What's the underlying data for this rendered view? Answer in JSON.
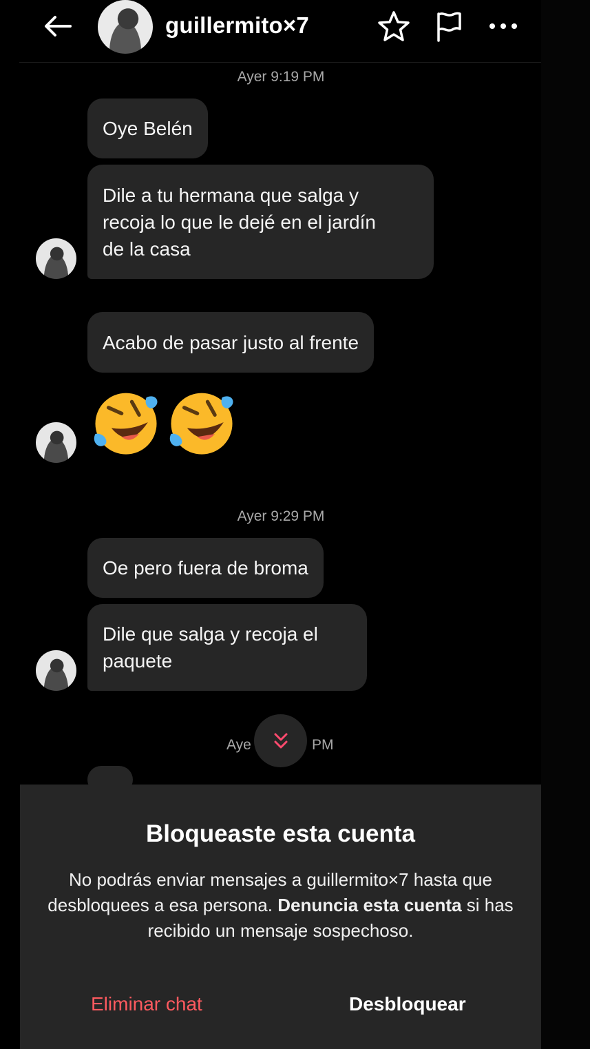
{
  "header": {
    "username": "guillermito×7"
  },
  "messages": {
    "ts1": "Ayer 9:19 PM",
    "m1": "Oye Belén",
    "m2_line1": "Dile a tu hermana que salga y",
    "m2_line2": "recoja lo que le dejé en el jardín",
    "m2_line3": "de la casa",
    "m3": "Acabo de pasar justo al frente",
    "ts2": "Ayer 9:29 PM",
    "m4": "Oe pero fuera de broma",
    "m5_line1": "Dile que salga y recoja el",
    "m5_line2": "paquete",
    "ts3_left": "Aye",
    "ts3_right": "PM"
  },
  "emoji": [
    "rolling-on-floor-laughing",
    "rolling-on-floor-laughing"
  ],
  "blocked": {
    "title": "Bloqueaste esta cuenta",
    "body_part1": "No podrás enviar mensajes a guillermito×7 hasta que desbloquees a esa persona. ",
    "body_bold": "Denuncia esta cuenta",
    "body_part2": " si has recibido un mensaje sospechoso.",
    "delete_label": "Eliminar chat",
    "unblock_label": "Desbloquear"
  },
  "colors": {
    "background": "#000000",
    "bubble": "#262626",
    "timestamp": "#a8a8a8",
    "danger": "#ff5a5f"
  }
}
